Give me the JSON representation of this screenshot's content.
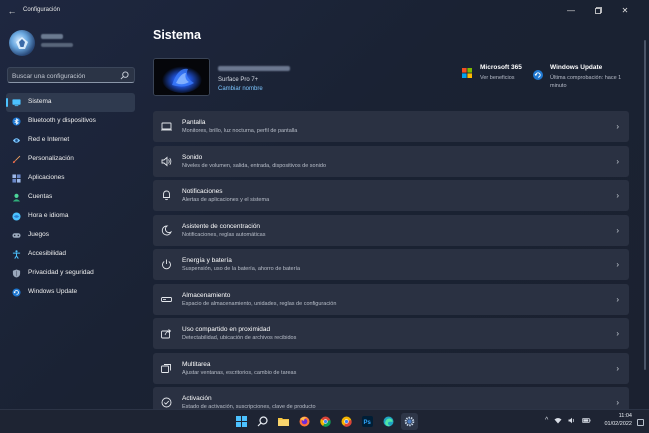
{
  "window": {
    "title": "Configuración",
    "back_icon": "back-arrow-icon",
    "controls": [
      "minimize-icon",
      "maximize-icon",
      "close-icon"
    ]
  },
  "sidebar": {
    "search_placeholder": "Buscar una configuración",
    "items": [
      {
        "label": "Sistema",
        "icon": "system-icon",
        "color": "#4cc2ff",
        "active": true
      },
      {
        "label": "Bluetooth y dispositivos",
        "icon": "bluetooth-icon",
        "color": "#4cc2ff"
      },
      {
        "label": "Red e Internet",
        "icon": "network-icon",
        "color": "#7ec8ff"
      },
      {
        "label": "Personalización",
        "icon": "brush-icon",
        "color": "#f0a060"
      },
      {
        "label": "Aplicaciones",
        "icon": "apps-icon",
        "color": "#9cb8e8"
      },
      {
        "label": "Cuentas",
        "icon": "accounts-icon",
        "color": "#4cd69a"
      },
      {
        "label": "Hora e idioma",
        "icon": "time-language-icon",
        "color": "#4cc2ff"
      },
      {
        "label": "Juegos",
        "icon": "gaming-icon",
        "color": "#9aa8bc"
      },
      {
        "label": "Accesibilidad",
        "icon": "accessibility-icon",
        "color": "#4cc2ff"
      },
      {
        "label": "Privacidad y seguridad",
        "icon": "shield-icon",
        "color": "#9aa8bc"
      },
      {
        "label": "Windows Update",
        "icon": "windows-update-icon",
        "color": "#4cc2ff"
      }
    ]
  },
  "main": {
    "title": "Sistema",
    "device": {
      "model": "Surface Pro 7+",
      "rename_link": "Cambiar nombre"
    },
    "ms365": {
      "title": "Microsoft 365",
      "subtitle": "Ver beneficios"
    },
    "windows_update": {
      "title": "Windows Update",
      "subtitle": "Última comprobación: hace 1 minuto"
    },
    "settings": [
      {
        "title": "Pantalla",
        "subtitle": "Monitores, brillo, luz nocturna, perfil de pantalla",
        "icon": "display-icon"
      },
      {
        "title": "Sonido",
        "subtitle": "Niveles de volumen, salida, entrada, dispositivos de sonido",
        "icon": "sound-icon"
      },
      {
        "title": "Notificaciones",
        "subtitle": "Alertas de aplicaciones y el sistema",
        "icon": "notifications-icon"
      },
      {
        "title": "Asistente de concentración",
        "subtitle": "Notificaciones, reglas automáticas",
        "icon": "focus-assist-icon"
      },
      {
        "title": "Energía y batería",
        "subtitle": "Suspensión, uso de la batería, ahorro de batería",
        "icon": "power-icon"
      },
      {
        "title": "Almacenamiento",
        "subtitle": "Espacio de almacenamiento, unidades, reglas de configuración",
        "icon": "storage-icon"
      },
      {
        "title": "Uso compartido en proximidad",
        "subtitle": "Detectabilidad, ubicación de archivos recibidos",
        "icon": "nearby-sharing-icon"
      },
      {
        "title": "Multitarea",
        "subtitle": "Ajustar ventanas, escritorios, cambio de tareas",
        "icon": "multitasking-icon"
      },
      {
        "title": "Activación",
        "subtitle": "Estado de activación, suscripciones, clave de producto",
        "icon": "activation-icon"
      }
    ]
  },
  "taskbar": {
    "apps": [
      "start-icon",
      "search-icon",
      "file-explorer-icon",
      "firefox-icon",
      "chrome-icon",
      "chrome-alt-icon",
      "photoshop-icon",
      "edge-icon",
      "settings-gear-icon"
    ],
    "photoshop_label": "Ps",
    "time": "11:04",
    "date": "01/02/2022"
  },
  "colors": {
    "accent": "#4cc2ff",
    "background": "#1c2436",
    "card": "#2a3142"
  }
}
